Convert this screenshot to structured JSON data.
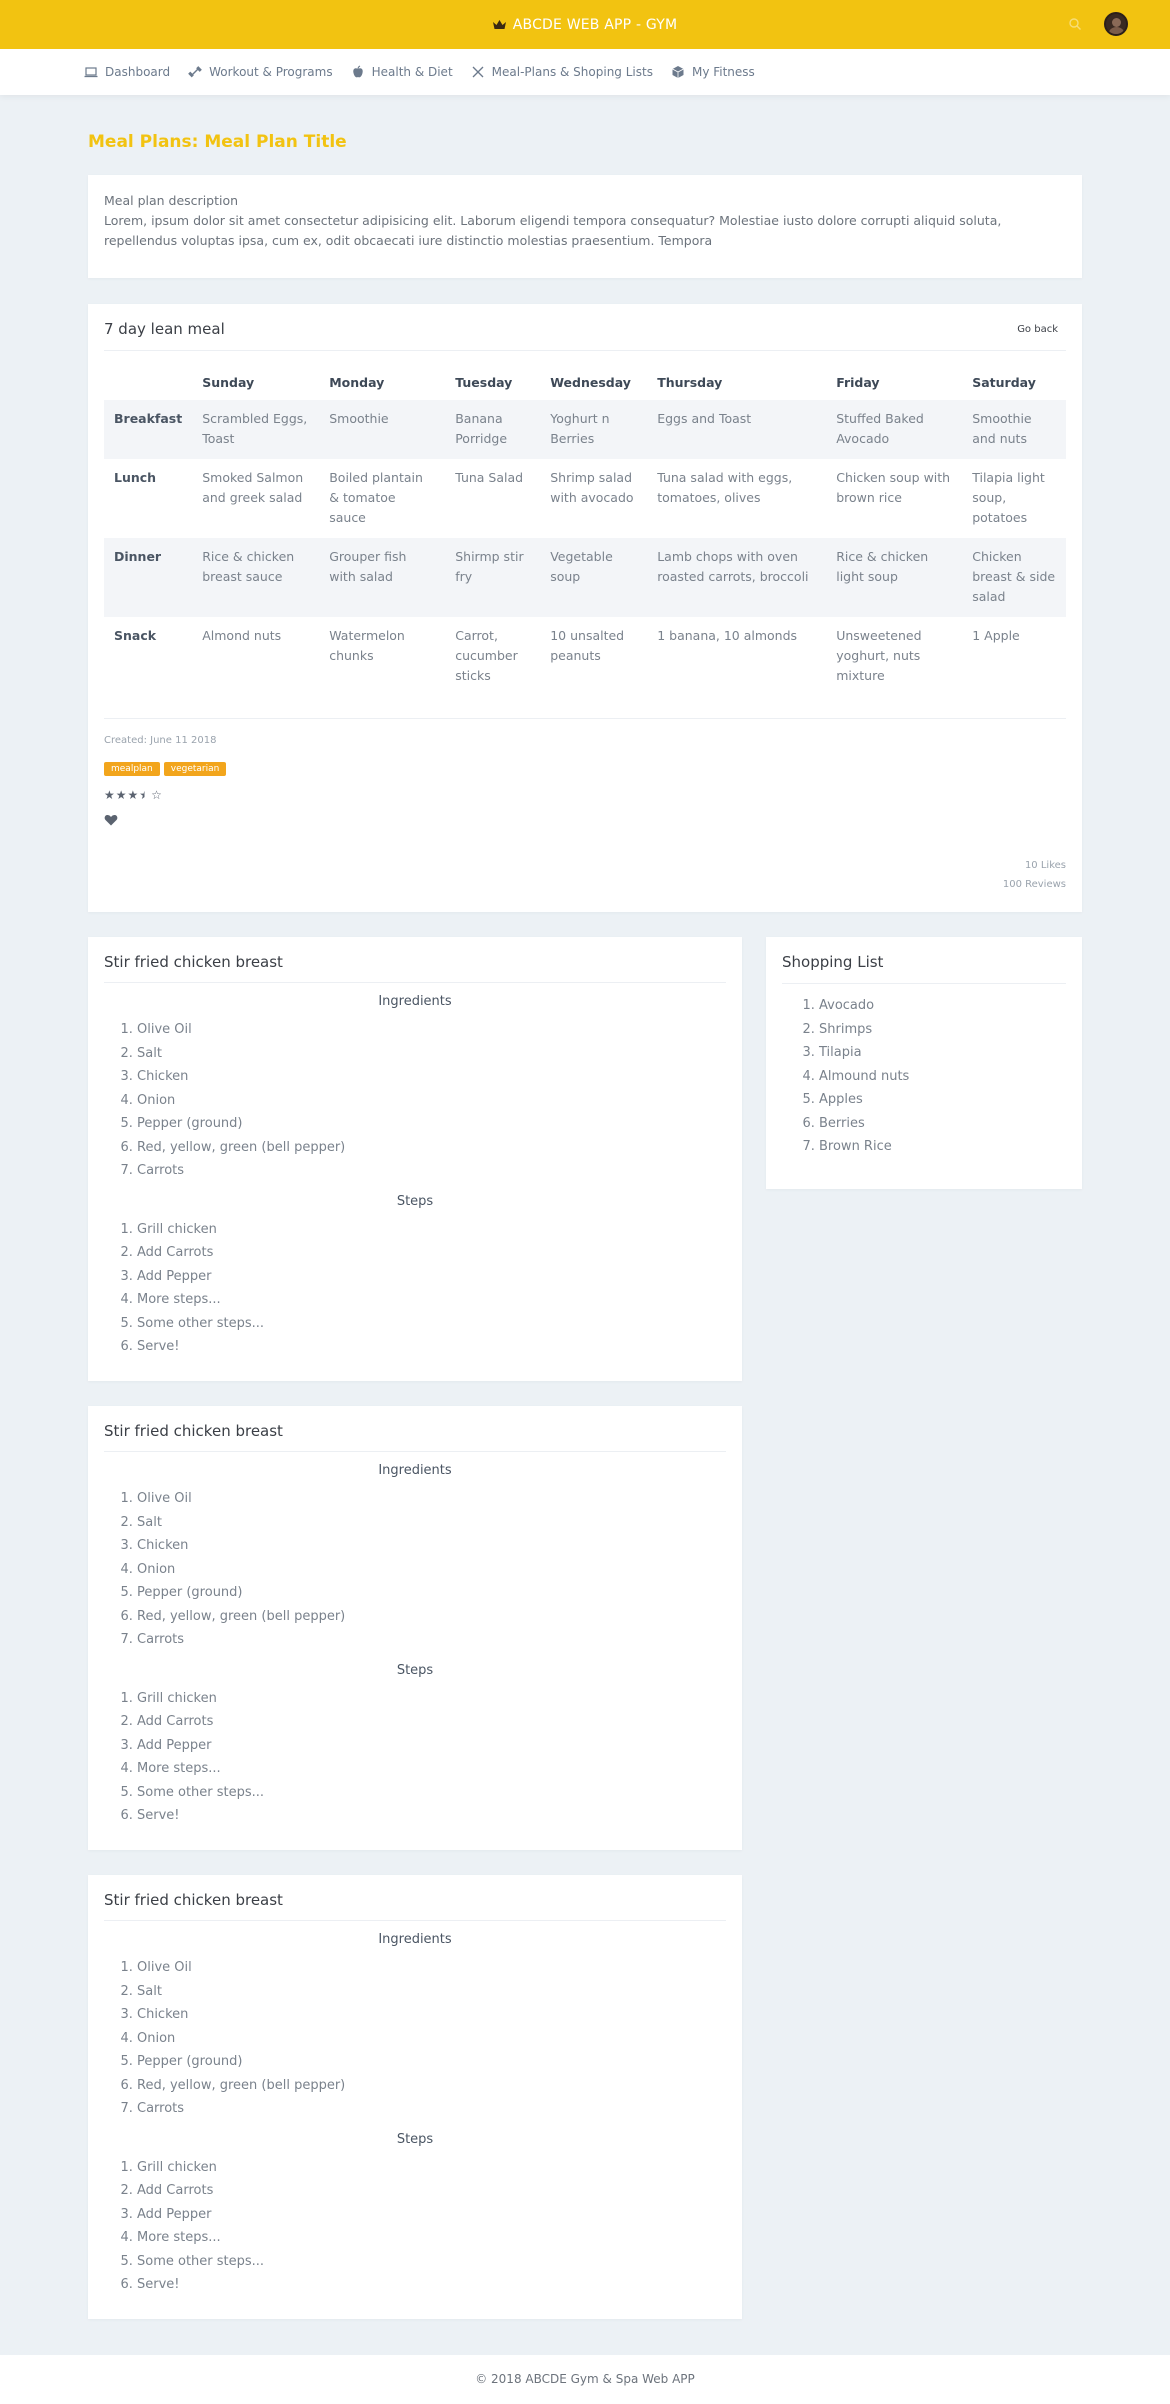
{
  "app": {
    "title": "ABCDE WEB APP - GYM"
  },
  "nav": [
    {
      "label": "Dashboard",
      "icon": "laptop-icon"
    },
    {
      "label": "Workout & Programs",
      "icon": "dumbbell-icon"
    },
    {
      "label": "Health & Diet",
      "icon": "apple-icon"
    },
    {
      "label": "Meal-Plans & Shoping Lists",
      "icon": "utensils-icon"
    },
    {
      "label": "My Fitness",
      "icon": "cube-icon"
    }
  ],
  "page": {
    "title": "Meal Plans: Meal Plan Title"
  },
  "description": {
    "heading": "Meal plan description",
    "text": "Lorem, ipsum dolor sit amet consectetur adipisicing elit. Laborum eligendi tempora consequatur? Molestiae iusto dolore corrupti aliquid soluta, repellendus voluptas ipsa, cum ex, odit obcaecati iure distinctio molestias praesentium. Tempora"
  },
  "plan": {
    "title": "7 day lean meal",
    "go_back": "Go back",
    "days": [
      "Sunday",
      "Monday",
      "Tuesday",
      "Wednesday",
      "Thursday",
      "Friday",
      "Saturday"
    ],
    "rows": [
      {
        "label": "Breakfast",
        "cells": [
          "Scrambled Eggs, Toast",
          "Smoothie",
          "Banana Porridge",
          "Yoghurt n Berries",
          "Eggs and Toast",
          "Stuffed Baked Avocado",
          "Smoothie and nuts"
        ]
      },
      {
        "label": "Lunch",
        "cells": [
          "Smoked Salmon and greek salad",
          "Boiled plantain & tomatoe sauce",
          "Tuna Salad",
          "Shrimp salad with avocado",
          "Tuna salad with eggs, tomatoes, olives",
          "Chicken soup with brown rice",
          "Tilapia light soup, potatoes"
        ]
      },
      {
        "label": "Dinner",
        "cells": [
          "Rice & chicken breast sauce",
          "Grouper fish with salad",
          "Shirmp stir fry",
          "Vegetable soup",
          "Lamb chops with oven roasted carrots, broccoli",
          "Rice & chicken light soup",
          "Chicken breast & side salad"
        ]
      },
      {
        "label": "Snack",
        "cells": [
          "Almond nuts",
          "Watermelon chunks",
          "Carrot, cucumber sticks",
          "10 unsalted peanuts",
          "1 banana, 10 almonds",
          "Unsweetened yoghurt, nuts mixture",
          "1 Apple"
        ]
      }
    ],
    "created": "Created: June 11 2018",
    "tags": [
      "mealplan",
      "vegetarian"
    ],
    "rating": 3.5,
    "likes": "10 Likes",
    "reviews": "100 Reviews"
  },
  "recipes": [
    {
      "title": "Stir fried chicken breast",
      "ingredients_label": "Ingredients",
      "ingredients": [
        "Olive Oil",
        "Salt",
        "Chicken",
        "Onion",
        "Pepper (ground)",
        "Red, yellow, green (bell pepper)",
        "Carrots"
      ],
      "steps_label": "Steps",
      "steps": [
        "Grill chicken",
        "Add Carrots",
        "Add Pepper",
        "More steps...",
        "Some other steps...",
        "Serve!"
      ]
    },
    {
      "title": "Stir fried chicken breast",
      "ingredients_label": "Ingredients",
      "ingredients": [
        "Olive Oil",
        "Salt",
        "Chicken",
        "Onion",
        "Pepper (ground)",
        "Red, yellow, green (bell pepper)",
        "Carrots"
      ],
      "steps_label": "Steps",
      "steps": [
        "Grill chicken",
        "Add Carrots",
        "Add Pepper",
        "More steps...",
        "Some other steps...",
        "Serve!"
      ]
    },
    {
      "title": "Stir fried chicken breast",
      "ingredients_label": "Ingredients",
      "ingredients": [
        "Olive Oil",
        "Salt",
        "Chicken",
        "Onion",
        "Pepper (ground)",
        "Red, yellow, green (bell pepper)",
        "Carrots"
      ],
      "steps_label": "Steps",
      "steps": [
        "Grill chicken",
        "Add Carrots",
        "Add Pepper",
        "More steps...",
        "Some other steps...",
        "Serve!"
      ]
    }
  ],
  "shopping": {
    "title": "Shopping List",
    "items": [
      "Avocado",
      "Shrimps",
      "Tilapia",
      "Almound nuts",
      "Apples",
      "Berries",
      "Brown Rice"
    ]
  },
  "footer": {
    "text": "© 2018 ABCDE Gym & Spa Web APP"
  },
  "colors": {
    "accent": "#f2c311",
    "background": "#ecf1f5",
    "tag": "#f2a51c"
  }
}
